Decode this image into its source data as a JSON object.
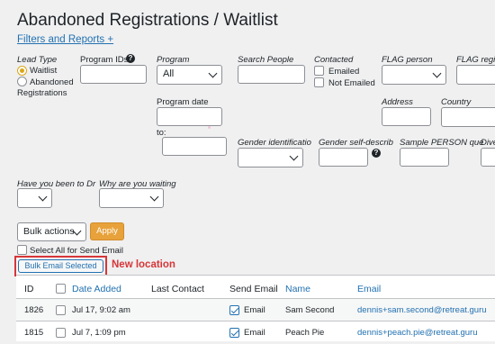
{
  "page": {
    "title": "Abandoned Registrations / Waitlist",
    "filters_link": "Filters and Reports +"
  },
  "filters": {
    "lead_type_label": "Lead Type",
    "lead_type_options": [
      "Waitlist",
      "Abandoned",
      "Registrations"
    ],
    "program_ids_label": "Program IDs",
    "program_label": "Program",
    "program_value": "All",
    "search_people_label": "Search People",
    "contacted_label": "Contacted",
    "contacted_options": [
      "Emailed",
      "Not Emailed"
    ],
    "flag_person_label": "FLAG person",
    "flag_regis_label": "FLAG regis",
    "program_date_label": "Program date",
    "to_label": "to:",
    "address_label": "Address",
    "country_label": "Country",
    "gender_identification_label": "Gender identificatio",
    "gender_self_describe_label": "Gender self-describ",
    "sample_person_label": "Sample PERSON que",
    "dive_label": "Dive",
    "have_you_been_label": "Have you been to Dr",
    "why_waiting_label": "Why are you waiting"
  },
  "actions": {
    "bulk_actions": "Bulk actions",
    "apply": "Apply",
    "select_all": "Select All for Send Email",
    "bulk_email": "Bulk Email Selected",
    "annotation": "New location"
  },
  "table": {
    "headers": [
      "ID",
      "Date Added",
      "Last Contact",
      "Send Email",
      "Name",
      "Email"
    ],
    "rows": [
      {
        "id": "1826",
        "date": "Jul 17, 9:02 am",
        "last_contact": "",
        "send_email": "Email",
        "name": "Sam Second",
        "email": "dennis+sam.second@retreat.guru"
      },
      {
        "id": "1815",
        "date": "Jul 7, 1:09 pm",
        "last_contact": "",
        "send_email": "Email",
        "name": "Peach Pie",
        "email": "dennis+peach.pie@retreat.guru"
      }
    ]
  },
  "colors": {
    "accent": "#2271b1",
    "apply": "#e8a23b",
    "annotation": "#d63638",
    "radio_selected": "#dba617"
  }
}
